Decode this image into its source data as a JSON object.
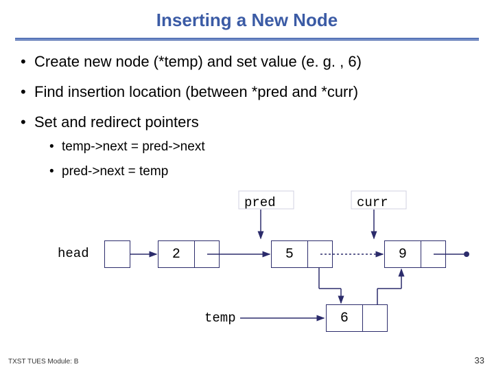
{
  "title": "Inserting a New Node",
  "bullets": {
    "b1": "Create new node (*temp) and set value (e. g. , 6)",
    "b2": "Find insertion location (between *pred and *curr)",
    "b3": "Set and redirect pointers",
    "s1": "temp->next = pred->next",
    "s2": "pred->next = temp"
  },
  "labels": {
    "head": "head",
    "pred": "pred",
    "curr": "curr",
    "temp": "temp"
  },
  "nodes": {
    "n2": "2",
    "n5": "5",
    "n9": "9",
    "n6": "6"
  },
  "footer": {
    "left": "TXST TUES Module: B",
    "right": "33"
  }
}
